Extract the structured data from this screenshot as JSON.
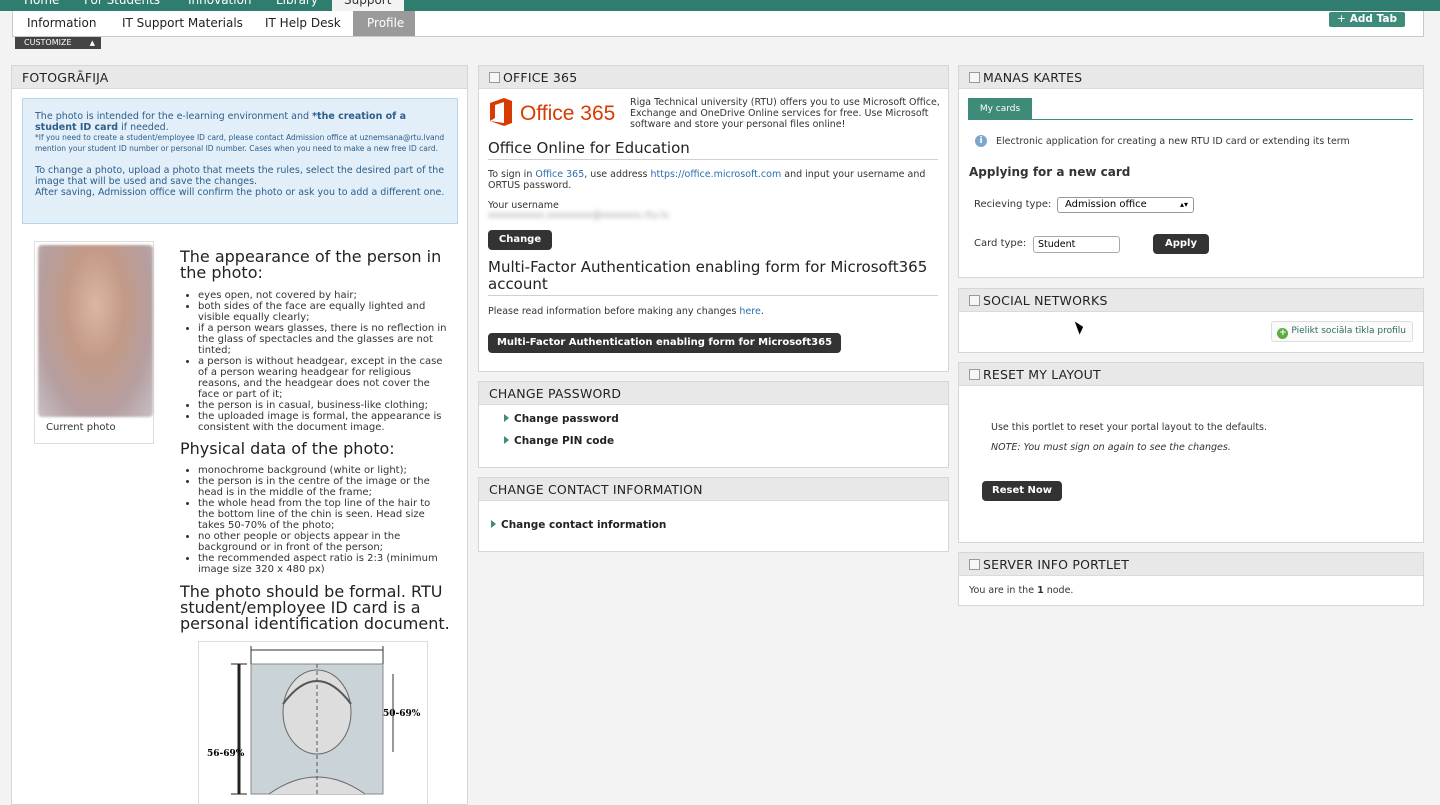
{
  "top_nav": {
    "tabs": [
      {
        "label": "Home"
      },
      {
        "label": "For Students"
      },
      {
        "label": "Innovation"
      },
      {
        "label": "Library"
      },
      {
        "label": "Support"
      }
    ]
  },
  "sub_nav": {
    "tabs": [
      {
        "label": "Information"
      },
      {
        "label": "IT Support Materials"
      },
      {
        "label": "IT Help Desk"
      },
      {
        "label": "Profile"
      }
    ],
    "add_tab": "Add Tab",
    "customize": "CUSTOMIZE"
  },
  "photo_portlet": {
    "title": "FOTOGRĀFIJA",
    "info_1a": "The photo is intended for the e-learning environment and ",
    "info_1b": "*the creation of a student ID card",
    "info_1c": " if needed.",
    "info_small": "*If you need to create a student/employee ID card, please contact Admission office at uznemsana@rtu.lvand mention your student ID number or personal ID number. Cases when you need to make a new free ID card.",
    "info_2": "To change a photo, upload a photo that meets the rules, select the desired part of the image that will be used and save the changes.",
    "info_3": "After saving, Admission office will confirm the photo or ask you to add a different one.",
    "current_photo": "Current photo",
    "appearance_heading": "The appearance of the person in the photo:",
    "appearance_rules": [
      "eyes open, not covered by hair;",
      "both sides of the face are equally lighted and visible equally clearly;",
      "if a person wears glasses, there is no reflection in the glass of spectacles and the glasses are not tinted;",
      "a person is without headgear, except in the case of a person wearing headgear for religious reasons, and the headgear does not cover the face or part of it;",
      "the person is in casual, business-like clothing;",
      "the uploaded image is formal, the appearance is consistent with the document image."
    ],
    "physical_heading": "Physical data of the photo:",
    "physical_rules": [
      "monochrome background (white or light);",
      "the person is in the centre of the image or the head is in the middle of the frame;",
      "the whole head from the top line of the hair to the bottom line of the chin is seen. Head size takes 50-70% of the photo;",
      "no other people or objects appear in the background or in front of the person;",
      "the recommended aspect ratio is 2:3 (minimum image size 320 x 480 px)"
    ],
    "formal_heading": "The photo should be formal. RTU student/employee ID card is a personal identification document.",
    "diagram_left": "56-69%",
    "diagram_right": "50-69%"
  },
  "office_portlet": {
    "title": "OFFICE 365",
    "logo_text": "Office 365",
    "intro": "Riga Technical university (RTU) offers you to use Microsoft Office, Exchange and OneDrive Online services for free. Use Microsoft software and store your personal files online!",
    "education_heading": "Office Online for Education",
    "signin_a": "To sign in ",
    "signin_link1": "Office 365",
    "signin_b": ", use address ",
    "signin_link2": "https://office.microsoft.com",
    "signin_c": " and input your username and ORTUS password.",
    "username_label": "Your username",
    "username_value": "xxxxxxxxxx.xxxxxxxx@xxxxxxx.rtu.lv",
    "change_button": "Change",
    "mfa_heading": "Multi-Factor Authentication enabling form for Microsoft365 account",
    "mfa_text_a": "Please read information before making any changes ",
    "mfa_link": "here",
    "mfa_text_b": ".",
    "mfa_button": "Multi-Factor Authentication enabling form for Microsoft365 account"
  },
  "change_password": {
    "title": "CHANGE PASSWORD",
    "links": [
      "Change password",
      "Change PIN code"
    ]
  },
  "change_contact": {
    "title": "CHANGE CONTACT INFORMATION",
    "link": "Change contact information"
  },
  "cards_portlet": {
    "title": "MANAS KARTES",
    "tab": "My cards",
    "info": "Electronic application for creating a new RTU ID card or extending its term",
    "heading": "Applying for a new card",
    "receiving_label": "Recieving type:",
    "receiving_value": "Admission office",
    "card_type_label": "Card type:",
    "card_type_value": "Student",
    "apply_button": "Apply"
  },
  "social_portlet": {
    "title": "SOCIAL NETWORKS",
    "add_button": "Pielikt sociāla tīkla profilu"
  },
  "reset_portlet": {
    "title": "RESET MY LAYOUT",
    "text": "Use this portlet to reset your portal layout to the defaults.",
    "note": "NOTE: You must sign on again to see the changes.",
    "button": "Reset Now"
  },
  "server_portlet": {
    "title": "SERVER INFO PORTLET",
    "text_a": "You are in the ",
    "node": "1",
    "text_b": " node."
  },
  "colors": {
    "brand_green": "#3e8b7a",
    "office_red": "#d83b01",
    "link_blue": "#2a6db0"
  }
}
